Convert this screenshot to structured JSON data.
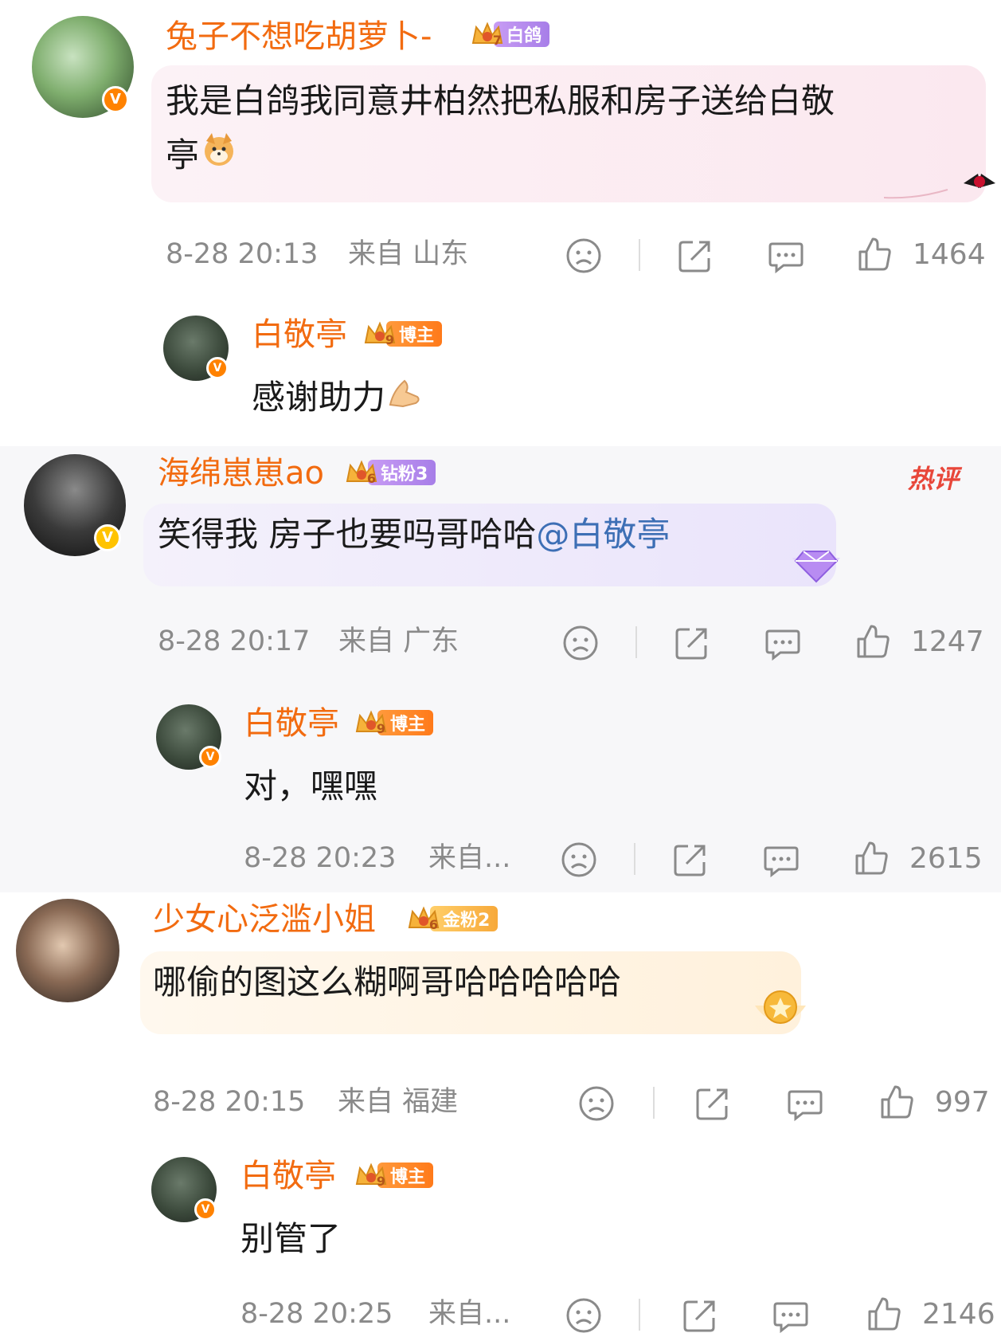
{
  "comments": [
    {
      "user": "兔子不想吃胡萝卜-",
      "badge_label": "白鸽",
      "badge_level": "7",
      "text_line1": "我是白鸽我同意井柏然把私服和房子送给白敬",
      "text_line2": "亭",
      "time": "8-28 20:13",
      "location": "来自 山东",
      "likes": "1464",
      "reply": {
        "user": "白敬亭",
        "badge_label": "博主",
        "badge_level": "9",
        "text": "感谢助力",
        "time": "",
        "likes": ""
      }
    },
    {
      "user": "海绵崽崽ao",
      "badge_label": "钻粉3",
      "badge_level": "6",
      "hot_label": "热评",
      "text_main": "笑得我 房子也要吗哥哈哈",
      "mention": "@白敬亭",
      "time": "8-28 20:17",
      "location": "来自 广东",
      "likes": "1247",
      "reply": {
        "user": "白敬亭",
        "badge_label": "博主",
        "badge_level": "9",
        "text": "对，嘿嘿",
        "time": "8-28 20:23",
        "location": "来自...",
        "likes": "2615"
      }
    },
    {
      "user": "少女心泛滥小姐",
      "badge_label": "金粉2",
      "badge_level": "6",
      "text_main": "哪偷的图这么糊啊哥哈哈哈哈哈",
      "time": "8-28 20:15",
      "location": "来自 福建",
      "likes": "997",
      "reply": {
        "user": "白敬亭",
        "badge_label": "博主",
        "badge_level": "9",
        "text": "别管了",
        "time": "8-28 20:25",
        "location": "来自...",
        "likes": "2146"
      }
    }
  ],
  "icons": {
    "sad_face": "sad-face-icon",
    "share": "share-icon",
    "comment": "comment-icon",
    "like": "thumbs-up-icon",
    "verified": "verified-v-icon",
    "crown": "crown-badge-icon"
  },
  "colors": {
    "username": "#f26b10",
    "mention": "#3d6fb5",
    "meta": "#8a8a8a",
    "hot": "#e8473a",
    "verified_orange": "#ff8200",
    "verified_yellow": "#ffc300"
  }
}
